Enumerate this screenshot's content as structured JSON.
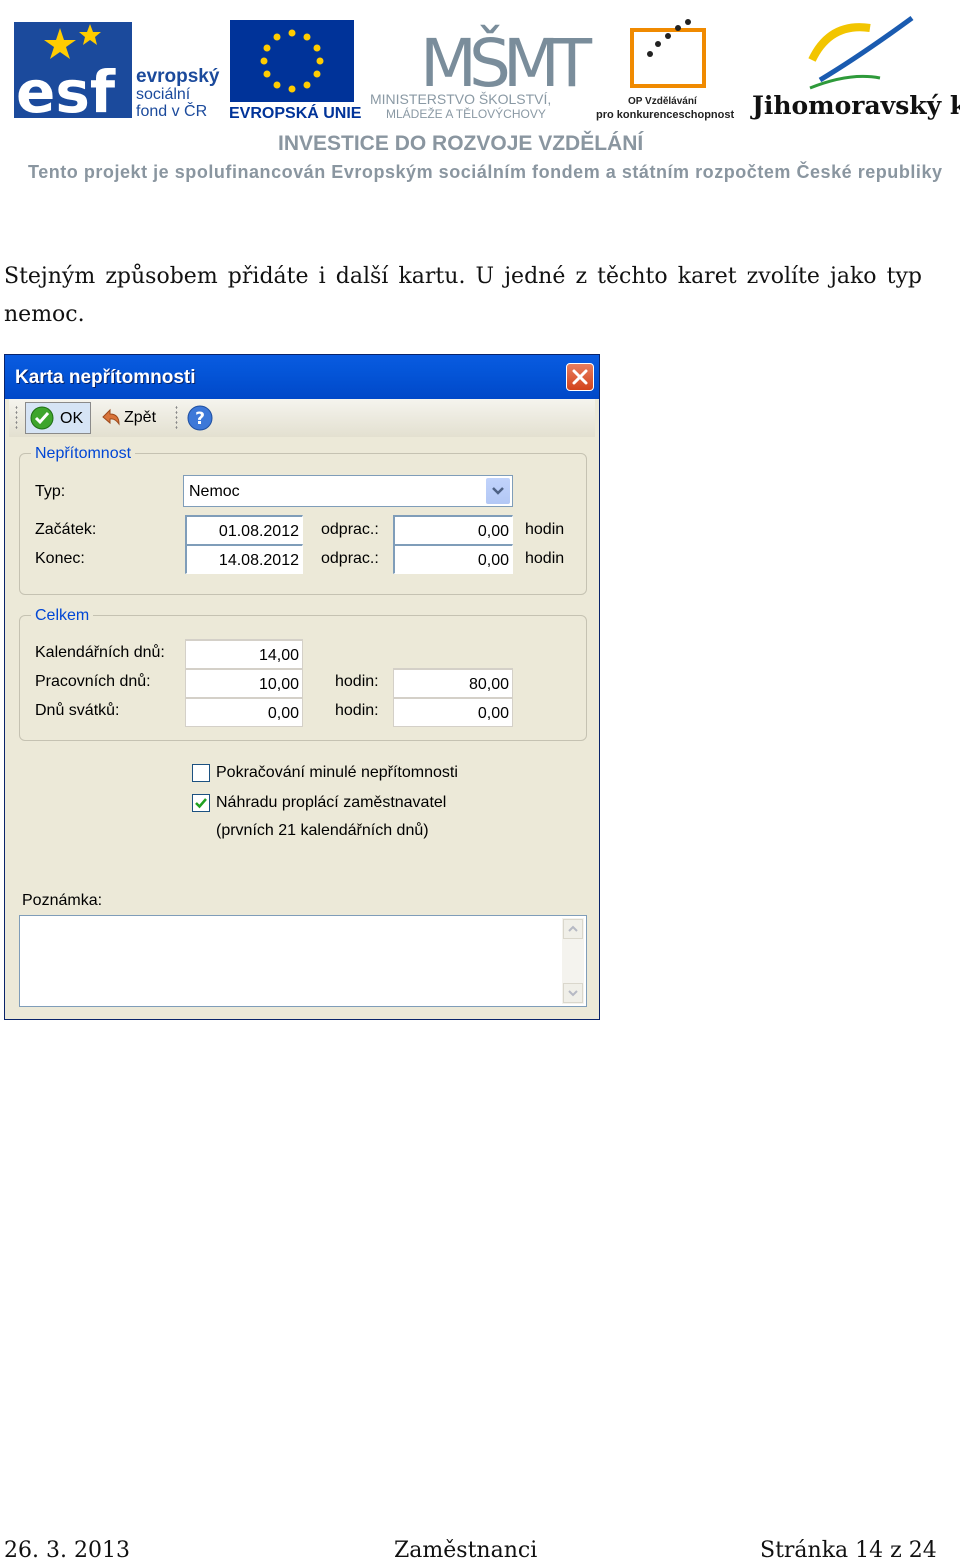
{
  "header": {
    "esf_title": "evropský",
    "esf_line2": "sociální",
    "esf_line3": "fond v ČR",
    "esf_letters": "esf",
    "eu_label": "EVROPSKÁ UNIE",
    "msmt_letters": "MŠMT",
    "msmt_line1": "MINISTERSTVO ŠKOLSTVÍ,",
    "msmt_line2": "MLÁDEŽE A TĚLOVÝCHOVY",
    "op_line1": "OP Vzdělávání",
    "op_line2": "pro konkurenceschopnost",
    "kraj_label": "Jihomoravský kraj",
    "investice": "INVESTICE DO ROZVOJE VZDĚLÁNÍ",
    "projekt": "Tento projekt je spolufinancován Evropským sociálním fondem a státním rozpočtem České republiky"
  },
  "paragraph": {
    "line1": "Stejným způsobem přidáte i další kartu. U jedné z těchto karet zvolíte jako typ",
    "line2": "nemoc."
  },
  "dialog": {
    "title": "Karta nepřítomnosti",
    "toolbar": {
      "ok_label": "OK",
      "back_label": "Zpět"
    },
    "absence_group": {
      "label": "Nepřítomnost",
      "type_label": "Typ:",
      "type_value": "Nemoc",
      "start_label": "Začátek:",
      "start_value": "01.08.2012",
      "end_label": "Konec:",
      "end_value": "14.08.2012",
      "worked_label": "odprac.:",
      "start_worked_value": "0,00",
      "end_worked_value": "0,00",
      "unit_hours": "hodin"
    },
    "total_group": {
      "label": "Celkem",
      "calendar_days_label": "Kalendářních dnů:",
      "calendar_days_value": "14,00",
      "work_days_label": "Pracovních dnů:",
      "work_days_value": "10,00",
      "work_hours_label": "hodin:",
      "work_hours_value": "80,00",
      "holiday_days_label": "Dnů svátků:",
      "holiday_days_value": "0,00",
      "holiday_hours_label": "hodin:",
      "holiday_hours_value": "0,00"
    },
    "checkboxes": {
      "continuation_label": "Pokračování minulé nepřítomnosti",
      "continuation_checked": false,
      "compensation_label": "Náhradu proplácí zaměstnavatel",
      "compensation_checked": true,
      "compensation_note": "(prvních 21 kalendářních dnů)"
    },
    "note_label": "Poznámka:",
    "note_value": ""
  },
  "footer": {
    "date": "26. 3. 2013",
    "title": "Zaměstnanci",
    "page": "Stránka 14 z 24"
  },
  "colors": {
    "xp_title_blue": "#0455d8",
    "group_label_blue": "#0046d5",
    "dialog_face": "#ece9d8",
    "esf_blue": "#1b4a9c",
    "eu_blue": "#003399",
    "eu_star_yellow": "#ffcc00",
    "op_orange": "#f08a00"
  }
}
